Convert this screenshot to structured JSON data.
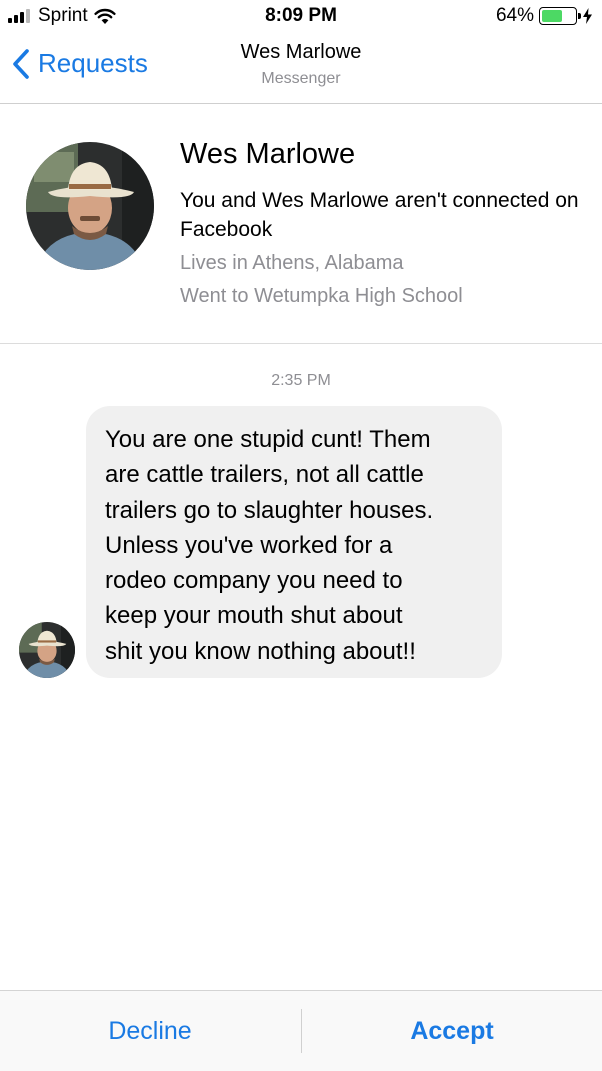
{
  "status_bar": {
    "carrier": "Sprint",
    "time": "8:09 PM",
    "battery_percent": "64%",
    "battery_level": 0.64,
    "signal_bars_filled": 3,
    "icons": [
      "signal-icon",
      "wifi-icon",
      "battery-icon",
      "charging-bolt-icon"
    ]
  },
  "nav": {
    "back_label": "Requests",
    "title": "Wes Marlowe",
    "subtitle": "Messenger",
    "accent_color": "#1a7ae3"
  },
  "profile": {
    "name": "Wes Marlowe",
    "connection_text": "You and Wes Marlowe aren't connected on Facebook",
    "lives_in": "Lives in Athens, Alabama",
    "school": "Went to Wetumpka High School"
  },
  "conversation": {
    "timestamp": "2:35 PM",
    "message": "You are one stupid cunt! Them\nare cattle trailers, not all cattle\ntrailers go to slaughter houses.\nUnless you've worked for a\nrodeo company you need to\nkeep your mouth shut about\nshit you know nothing about!!",
    "bubble_color": "#f0f0f0"
  },
  "actions": {
    "decline_label": "Decline",
    "accept_label": "Accept"
  }
}
